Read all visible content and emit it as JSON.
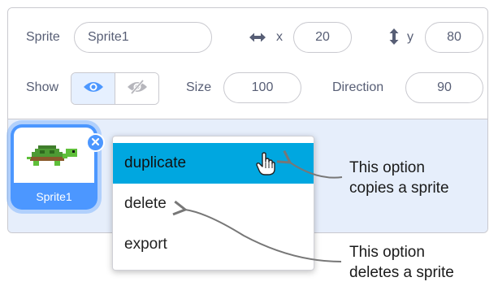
{
  "sprite_info": {
    "sprite_label": "Sprite",
    "sprite_name": "Sprite1",
    "x_label": "x",
    "x_value": "20",
    "y_label": "y",
    "y_value": "80",
    "show_label": "Show",
    "show_visible": true,
    "size_label": "Size",
    "size_value": "100",
    "direction_label": "Direction",
    "direction_value": "90"
  },
  "sprite_list": [
    {
      "name": "Sprite1",
      "selected": true
    }
  ],
  "context_menu": {
    "items": [
      {
        "label": "duplicate",
        "highlighted": true
      },
      {
        "label": "delete",
        "highlighted": false
      },
      {
        "label": "export",
        "highlighted": false
      }
    ]
  },
  "callouts": {
    "duplicate_line1": "This option",
    "duplicate_line2": "copies a sprite",
    "delete_line1": "This option",
    "delete_line2": "deletes a sprite"
  },
  "colors": {
    "accent": "#4c97ff",
    "menu_highlight": "#00a7e0",
    "sprite_area_bg": "#e6eefb",
    "text": "#575e75"
  },
  "icons": [
    "horizontal-arrows-icon",
    "vertical-arrows-icon",
    "eye-icon",
    "eye-hidden-icon",
    "close-icon",
    "hand-pointer-icon",
    "turtle-icon"
  ]
}
